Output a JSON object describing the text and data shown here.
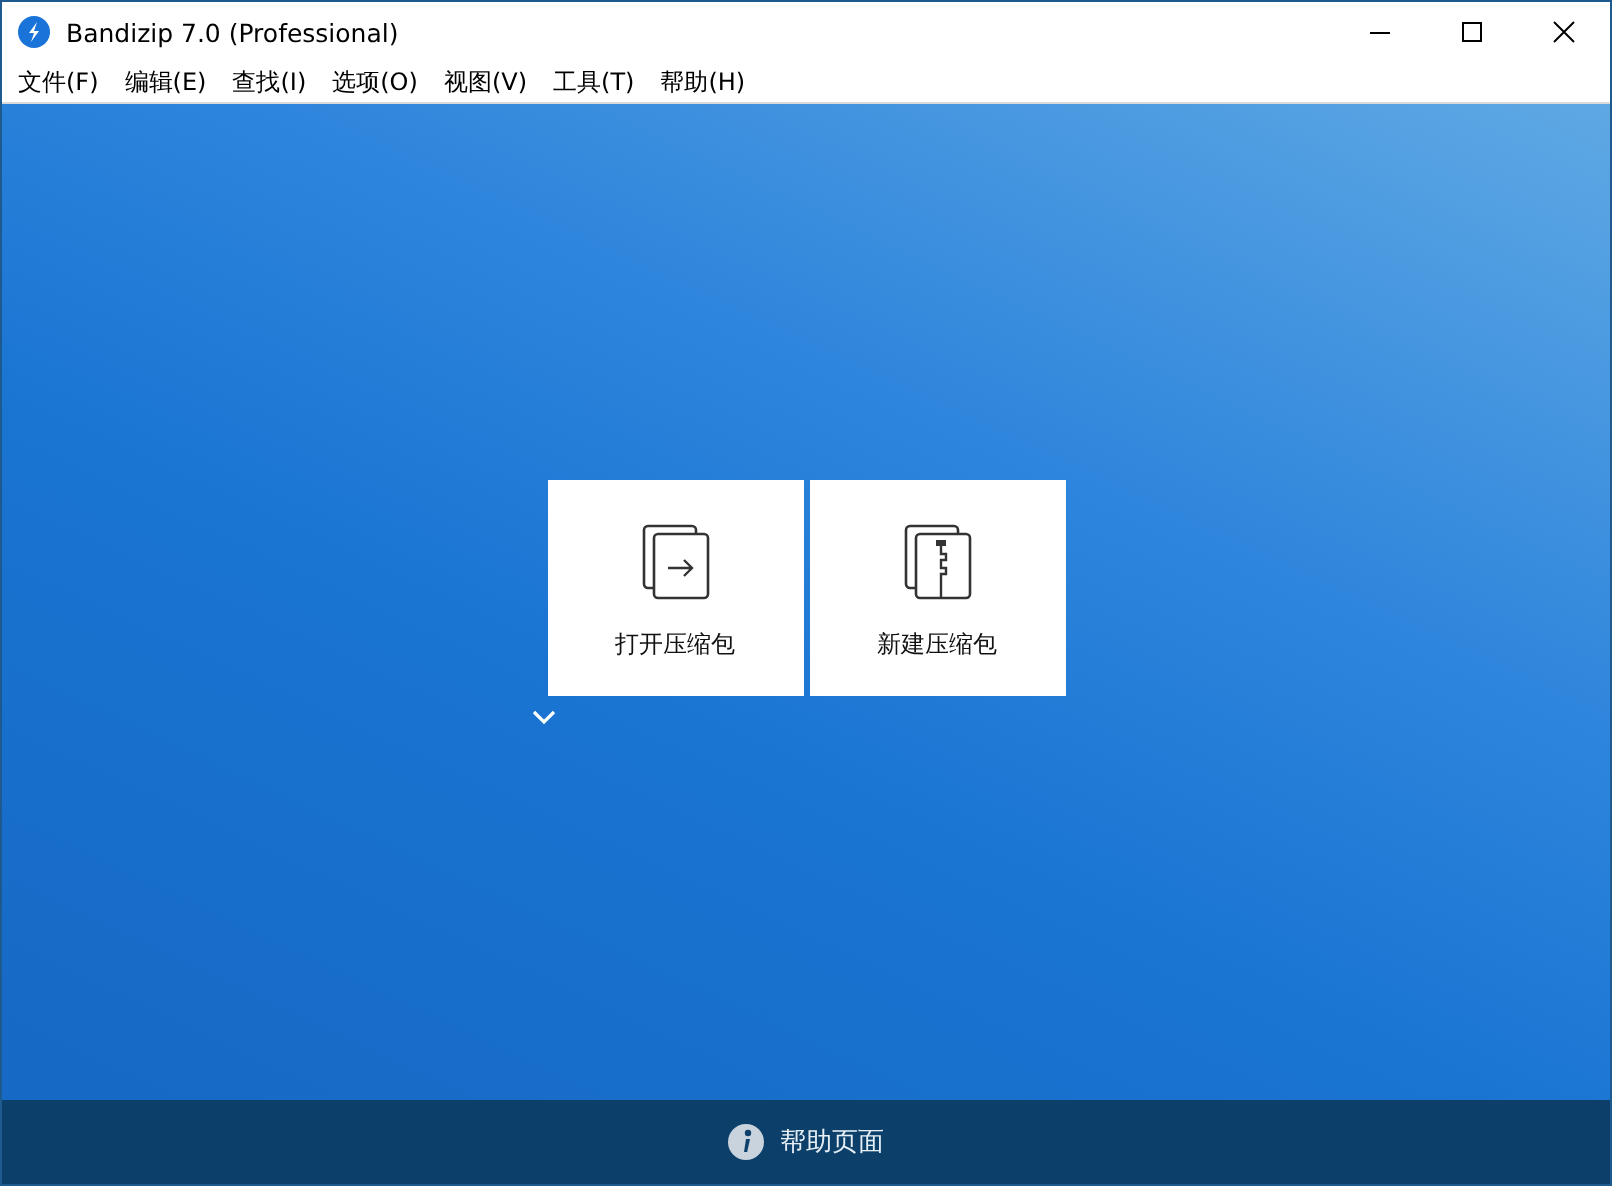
{
  "window": {
    "title": "Bandizip 7.0 (Professional)"
  },
  "menu": [
    "文件(F)",
    "编辑(E)",
    "查找(I)",
    "选项(O)",
    "视图(V)",
    "工具(T)",
    "帮助(H)"
  ],
  "tiles": [
    {
      "kind": "open",
      "label": "打开压缩包"
    },
    {
      "kind": "new",
      "label": "新建压缩包"
    }
  ],
  "status_bar": {
    "help_link": "帮助页面"
  }
}
